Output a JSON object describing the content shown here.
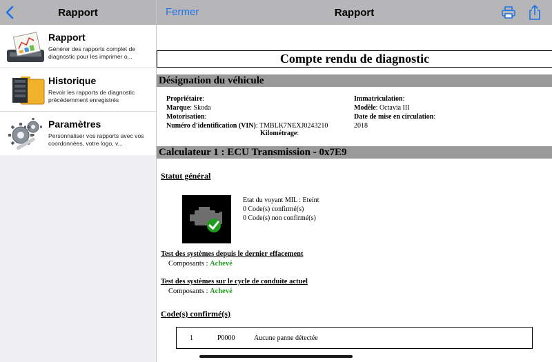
{
  "left": {
    "nav_title": "Rapport",
    "menu": [
      {
        "title": "Rapport",
        "desc": "Générer des rapports complet de diagnostic pour les imprimer o...",
        "icon": "report-printer-icon"
      },
      {
        "title": "Historique",
        "desc": "Revoir les rapports de diagnostic précédemment enregistrés",
        "icon": "history-folder-icon"
      },
      {
        "title": "Paramètres",
        "desc": "Personnaliser vos rapports avec vos coordonnées, votre logo, v...",
        "icon": "settings-gears-icon"
      }
    ]
  },
  "right": {
    "close_label": "Fermer",
    "nav_title": "Rapport"
  },
  "report": {
    "title": "Compte rendu de diagnostic",
    "vehicle_section": "Désignation du véhicule",
    "vehicle": {
      "owner_label": "Propriétaire",
      "owner_value": "",
      "make_label": "Marque",
      "make_value": "Skoda",
      "engine_label": "Motorisation",
      "engine_value": "",
      "vin_label": "Numéro d'identification (VIN)",
      "vin_value": "TMBLK7NEXJ0243210",
      "km_label": "Kilométrage",
      "km_value": "",
      "plate_label": "Immatriculation",
      "plate_value": "",
      "model_label": "Modèle",
      "model_value": "Octavia III",
      "date_label": "Date de mise en circulation",
      "date_value": "2018"
    },
    "ecu_section": "Calculateur 1 : ECU Transmission - 0x7E9",
    "status_head": "Statut général",
    "mil_status": "Etat du voyant MIL : Eteint",
    "confirmed_count": "0 Code(s) confirmé(s)",
    "unconfirmed_count": "0 Code(s) non confirmé(s)",
    "test1_head": "Test des systèmes depuis le dernier effacement",
    "test1_label": "Composants :",
    "test1_value": "Achevé",
    "test2_head": "Test des systèmes sur le cycle de conduite actuel",
    "test2_label": "Composants :",
    "test2_value": "Achevé",
    "confirmed_head": "Code(s) confirmé(s)",
    "codes": [
      {
        "index": "1",
        "code": "P0000",
        "desc": "Aucune panne détectée"
      }
    ]
  },
  "colors": {
    "nav_bg": "#b6b6b9",
    "accent": "#1a73e8",
    "band": "#9a9a9a",
    "ok_green": "#1e9c1e"
  }
}
